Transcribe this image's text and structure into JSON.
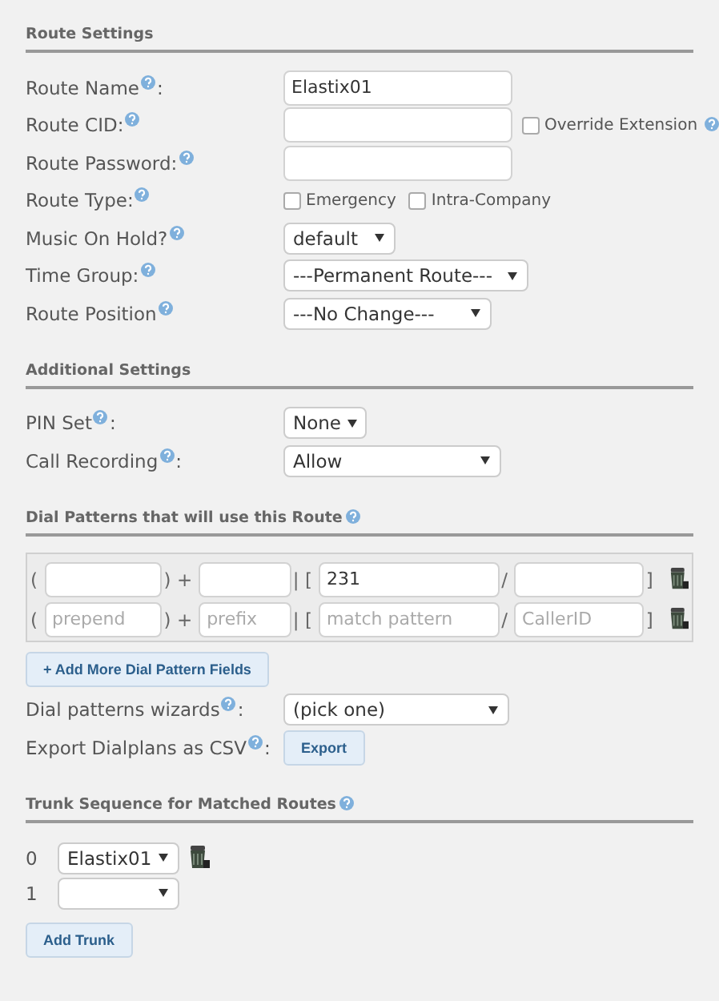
{
  "route_settings": {
    "heading": "Route Settings",
    "rows": [
      {
        "kind": "text",
        "label": "Route Name",
        "after_help": ":",
        "value": "Elastix01"
      },
      {
        "kind": "text_check",
        "label": "Route CID:",
        "check": {
          "label": "Override Extension",
          "checked": false,
          "help": true
        }
      },
      {
        "kind": "text",
        "label": "Route Password:"
      },
      {
        "kind": "checks",
        "label": "Route Type:",
        "checks": [
          {
            "label": "Emergency",
            "checked": false
          },
          {
            "label": "Intra-Company",
            "checked": false
          }
        ]
      },
      {
        "kind": "select",
        "label": "Music On Hold?",
        "value": "default"
      },
      {
        "kind": "select",
        "label": "Time Group:",
        "value": "---Permanent Route---"
      },
      {
        "kind": "select",
        "label": "Route Position",
        "value": "---No Change---"
      }
    ]
  },
  "additional_settings": {
    "heading": "Additional Settings",
    "rows": [
      {
        "kind": "select",
        "label": "PIN Set",
        "after_help": ":",
        "value": "None"
      },
      {
        "kind": "select",
        "label": "Call Recording",
        "after_help": ":",
        "value": "Allow"
      }
    ]
  },
  "dial_patterns": {
    "heading": "Dial Patterns that will use this Route",
    "rows": [
      {
        "separators": [
          "(",
          ") +",
          "| [",
          "/",
          "]"
        ],
        "fields": [
          {
            "kind": "blank"
          },
          {
            "kind": "blank"
          },
          {
            "kind": "value",
            "value": "231"
          },
          {
            "kind": "blank"
          }
        ]
      },
      {
        "separators": [
          "(",
          ") +",
          "| [",
          "/",
          "]"
        ],
        "fields": [
          {
            "kind": "hint",
            "placeholder": "prepend"
          },
          {
            "kind": "hint",
            "placeholder": "prefix"
          },
          {
            "kind": "hint",
            "placeholder": "match pattern"
          },
          {
            "kind": "hint",
            "placeholder": "CallerID"
          }
        ]
      }
    ],
    "add_button": "+ Add More Dial Pattern Fields",
    "rows_after": [
      {
        "kind": "select",
        "label": "Dial patterns wizards",
        "after_help": ":",
        "value": "(pick one)"
      },
      {
        "kind": "button",
        "label": "Export Dialplans as CSV",
        "after_help": ":",
        "button": "Export"
      }
    ]
  },
  "trunk_sequence": {
    "heading": "Trunk Sequence for Matched Routes",
    "trunks": [
      {
        "index": "0",
        "value": "Elastix01",
        "delete": true
      },
      {
        "index": "1",
        "delete": false
      }
    ],
    "add_button": "Add Trunk"
  }
}
